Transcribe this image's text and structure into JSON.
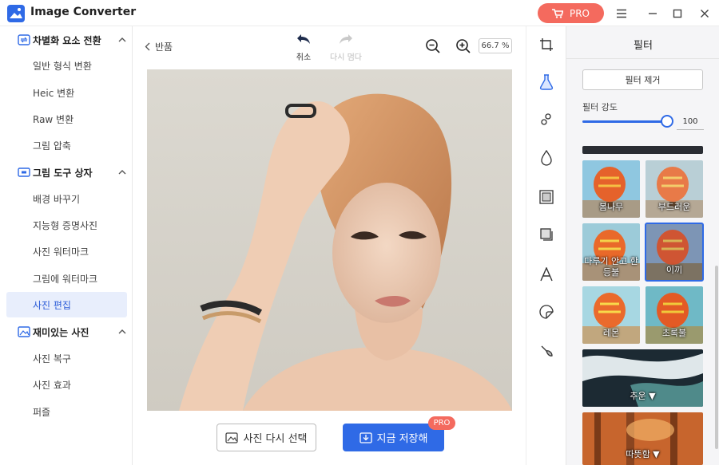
{
  "app": {
    "title": "Image Converter",
    "pro_label": "PRO"
  },
  "sidebar": {
    "categories": [
      {
        "label": "차별화 요소 전환",
        "icon": "convert-icon",
        "items": [
          "일반 형식 변환",
          "Heic 변환",
          "Raw 변환",
          "그림 압축"
        ]
      },
      {
        "label": "그림 도구 상자",
        "icon": "toolbox-icon",
        "items": [
          "배경 바꾸기",
          "지능형 증명사진",
          "사진 워터마크",
          "그림에 워터마크",
          "사진 편집"
        ]
      },
      {
        "label": "재미있는 사진",
        "icon": "fun-photo-icon",
        "items": [
          "사진 복구",
          "사진 효과",
          "퍼즐"
        ]
      }
    ],
    "active_item": "사진 편집"
  },
  "toolbar": {
    "back_label": "반품",
    "undo_label": "취소",
    "redo_label": "다시 멈다",
    "zoom_level": "66.7 %"
  },
  "actions": {
    "reselect_label": "사진 다시 선택",
    "save_label": "지금 저장해",
    "save_badge": "PRO"
  },
  "filter_panel": {
    "title": "필터",
    "remove_label": "필터 제거",
    "strength_label": "필터 강도",
    "strength_value": "100",
    "strength_fraction": 1.0,
    "filters": [
      {
        "label": "봄나무"
      },
      {
        "label": "부드러운"
      },
      {
        "label": "다루기 안고 한 등불"
      },
      {
        "label": "이끼",
        "selected": true
      },
      {
        "label": "레몬"
      },
      {
        "label": "초록불"
      },
      {
        "label": "추운 ▼"
      },
      {
        "label": "따뜻함 ▼"
      }
    ]
  },
  "colors": {
    "accent": "#2f6ae6",
    "pro": "#f46a5e"
  }
}
